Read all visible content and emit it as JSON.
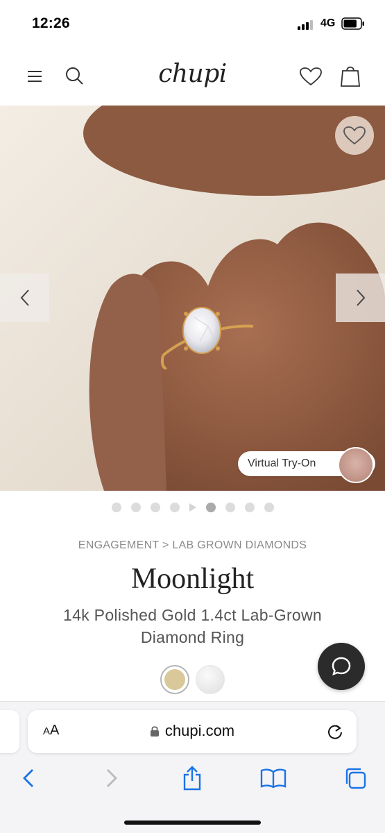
{
  "status_bar": {
    "time": "12:26",
    "network": "4G",
    "signal_bars": 3,
    "battery_level": 0.8
  },
  "header": {
    "logo": "chupi",
    "icons": [
      "menu-icon",
      "search-icon",
      "heart-icon",
      "bag-icon"
    ]
  },
  "gallery": {
    "virtual_tryon_label": "Virtual Try-On",
    "image_count": 9,
    "active_index": 5,
    "has_video": true
  },
  "product": {
    "breadcrumb": "ENGAGEMENT > LAB GROWN DIAMONDS",
    "name": "Moonlight",
    "description_line1": "14k Polished Gold 1.4ct Lab-Grown",
    "description_line2": "Diamond Ring",
    "swatches": [
      {
        "name": "gold",
        "color": "#d9c99a",
        "selected": true
      },
      {
        "name": "white",
        "color": "#ececec",
        "selected": false
      }
    ]
  },
  "browser": {
    "aa_label_small": "A",
    "aa_label_large": "A",
    "url": "chupi.com",
    "accent_color": "#1a73e8"
  }
}
